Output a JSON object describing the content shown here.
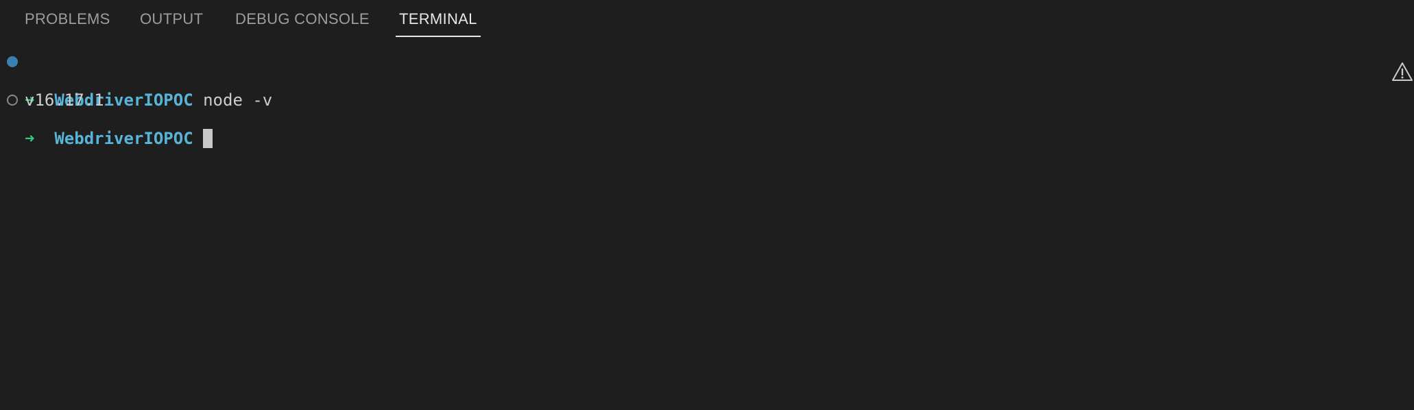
{
  "tabs": [
    {
      "label": "PROBLEMS"
    },
    {
      "label": "OUTPUT"
    },
    {
      "label": "DEBUG CONSOLE"
    },
    {
      "label": "TERMINAL",
      "active": true
    }
  ],
  "terminal": {
    "lines": [
      {
        "arrow": "➜",
        "cwd": "WebdriverIOPOC",
        "command": "node -v"
      },
      {
        "output": "v16.17.1"
      },
      {
        "arrow": "➜",
        "cwd": "WebdriverIOPOC",
        "command": ""
      }
    ]
  },
  "colors": {
    "background": "#1e1e1e",
    "tab_inactive": "#9d9d9d",
    "tab_active": "#e7e7e7",
    "prompt_arrow": "#2fcc7f",
    "prompt_cwd": "#58b4d8",
    "text": "#cccccc",
    "decoration_success": "#3c7fb1"
  },
  "icons": {
    "decoration_success": "filled-circle-icon",
    "decoration_default": "hollow-circle-icon",
    "warning": "warning-icon"
  }
}
